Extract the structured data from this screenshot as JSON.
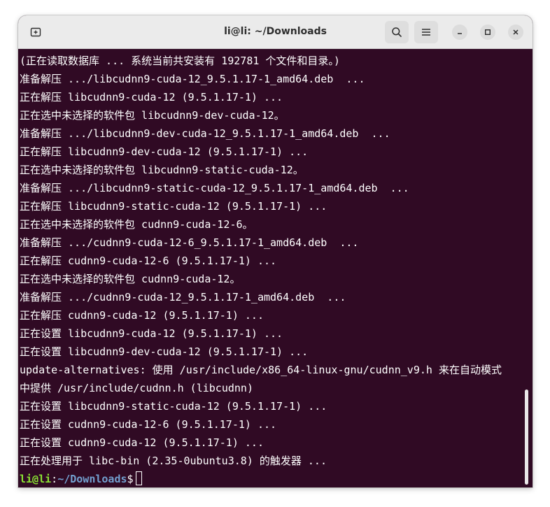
{
  "window": {
    "title": "li@li: ~/Downloads"
  },
  "titlebar": {
    "new_tab_icon": "new-tab-icon",
    "search_icon": "search-icon",
    "menu_icon": "hamburger-menu-icon",
    "minimize_icon": "minimize-icon",
    "maximize_icon": "maximize-icon",
    "close_icon": "close-icon"
  },
  "terminal": {
    "lines": [
      "(正在读取数据库 ... 系统当前共安装有 192781 个文件和目录。)",
      "准备解压 .../libcudnn9-cuda-12_9.5.1.17-1_amd64.deb  ...",
      "正在解压 libcudnn9-cuda-12 (9.5.1.17-1) ...",
      "正在选中未选择的软件包 libcudnn9-dev-cuda-12。",
      "准备解压 .../libcudnn9-dev-cuda-12_9.5.1.17-1_amd64.deb  ...",
      "正在解压 libcudnn9-dev-cuda-12 (9.5.1.17-1) ...",
      "正在选中未选择的软件包 libcudnn9-static-cuda-12。",
      "准备解压 .../libcudnn9-static-cuda-12_9.5.1.17-1_amd64.deb  ...",
      "正在解压 libcudnn9-static-cuda-12 (9.5.1.17-1) ...",
      "正在选中未选择的软件包 cudnn9-cuda-12-6。",
      "准备解压 .../cudnn9-cuda-12-6_9.5.1.17-1_amd64.deb  ...",
      "正在解压 cudnn9-cuda-12-6 (9.5.1.17-1) ...",
      "正在选中未选择的软件包 cudnn9-cuda-12。",
      "准备解压 .../cudnn9-cuda-12_9.5.1.17-1_amd64.deb  ...",
      "正在解压 cudnn9-cuda-12 (9.5.1.17-1) ...",
      "正在设置 libcudnn9-cuda-12 (9.5.1.17-1) ...",
      "正在设置 libcudnn9-dev-cuda-12 (9.5.1.17-1) ...",
      "update-alternatives: 使用 /usr/include/x86_64-linux-gnu/cudnn_v9.h 来在自动模式",
      "中提供 /usr/include/cudnn.h (libcudnn)",
      "正在设置 libcudnn9-static-cuda-12 (9.5.1.17-1) ...",
      "正在设置 cudnn9-cuda-12-6 (9.5.1.17-1) ...",
      "正在设置 cudnn9-cuda-12 (9.5.1.17-1) ...",
      "正在处理用于 libc-bin (2.35-0ubuntu3.8) 的触发器 ..."
    ],
    "prompt": {
      "user": "li@li",
      "separator": ":",
      "path": "~/Downloads",
      "symbol": "$"
    }
  },
  "colors": {
    "terminal_bg": "#300a24",
    "prompt_user": "#8ae234",
    "prompt_path": "#729fcf",
    "titlebar_bg": "#ebebeb"
  }
}
